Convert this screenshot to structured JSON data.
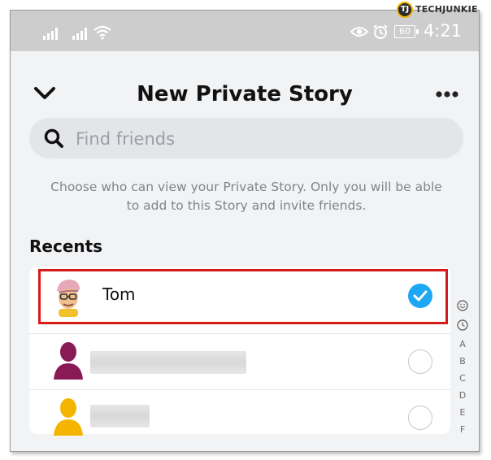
{
  "status_bar": {
    "time": "4:21",
    "battery": "60"
  },
  "watermark": {
    "logo_letter": "TJ",
    "text": "TECHJUNKIE"
  },
  "header": {
    "title": "New Private Story"
  },
  "search": {
    "placeholder": "Find friends"
  },
  "info_text": "Choose who can view your Private Story. Only you will be able to add to this Story and invite friends.",
  "recents": {
    "title": "Recents",
    "items": [
      {
        "name": "Tom",
        "selected": true,
        "avatar": "bitmoji-avatar"
      },
      {
        "name": "",
        "selected": false,
        "avatar": "silhouette-purple"
      },
      {
        "name": "",
        "selected": false,
        "avatar": "silhouette-yellow"
      }
    ]
  },
  "alpha_index": {
    "icons": [
      "smiley-icon",
      "clock-icon"
    ],
    "letters": [
      "A",
      "B",
      "C",
      "D",
      "E",
      "F"
    ]
  },
  "colors": {
    "accent": "#1ea7f5",
    "highlight_border": "#d71b1b",
    "status_bar": "#cdcdcd"
  }
}
